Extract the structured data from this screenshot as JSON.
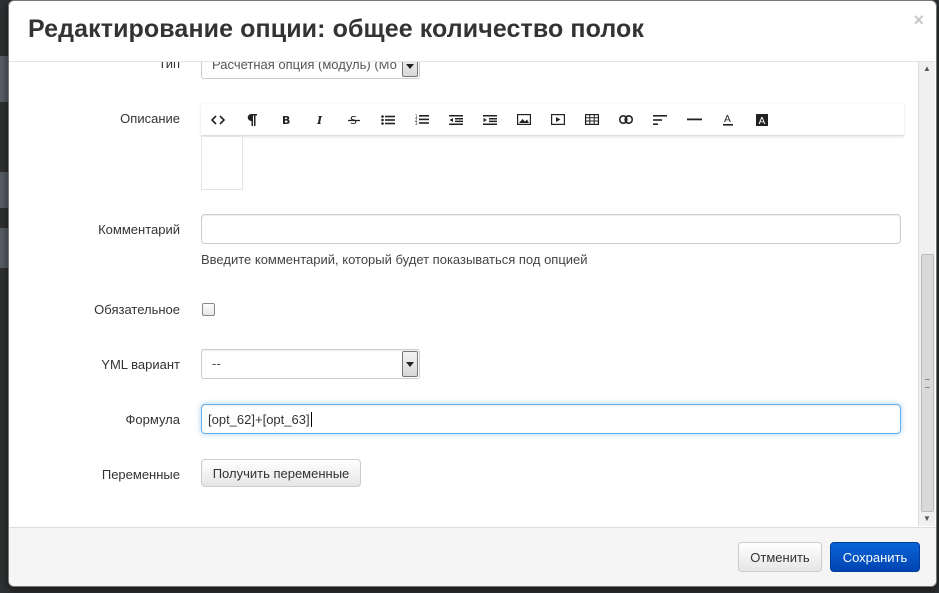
{
  "modal": {
    "title": "Редактирование опции: общее количество полок",
    "close_glyph": "×"
  },
  "form": {
    "type": {
      "label": "Тип",
      "value": "Расчетная опция (модуль) (Мо"
    },
    "description": {
      "label": "Описание",
      "toolbar": [
        {
          "icon": "code-view-icon",
          "glyph": "<>"
        },
        {
          "icon": "paragraph-icon",
          "glyph": "¶"
        },
        {
          "icon": "bold-icon",
          "glyph": "B"
        },
        {
          "icon": "italic-icon",
          "glyph": "I"
        },
        {
          "icon": "strikethrough-icon",
          "glyph": "S"
        },
        {
          "icon": "unordered-list-icon",
          "glyph": ""
        },
        {
          "icon": "ordered-list-icon",
          "glyph": ""
        },
        {
          "icon": "outdent-icon",
          "glyph": ""
        },
        {
          "icon": "indent-icon",
          "glyph": ""
        },
        {
          "icon": "image-icon",
          "glyph": ""
        },
        {
          "icon": "video-icon",
          "glyph": ""
        },
        {
          "icon": "table-icon",
          "glyph": ""
        },
        {
          "icon": "link-icon",
          "glyph": ""
        },
        {
          "icon": "align-icon",
          "glyph": ""
        },
        {
          "icon": "horizontal-rule-icon",
          "glyph": ""
        },
        {
          "icon": "font-color-icon",
          "glyph": "A"
        },
        {
          "icon": "background-color-icon",
          "glyph": "A"
        }
      ]
    },
    "comment": {
      "label": "Комментарий",
      "value": "",
      "help": "Введите комментарий, который будет показываться под опцией"
    },
    "required": {
      "label": "Обязательное",
      "checked": false
    },
    "yml_variant": {
      "label": "YML вариант",
      "value": "--"
    },
    "formula": {
      "label": "Формула",
      "value": "[opt_62]+[opt_63]"
    },
    "variables": {
      "label": "Переменные",
      "button_label": "Получить переменные"
    }
  },
  "footer": {
    "cancel_label": "Отменить",
    "save_label": "Сохранить"
  },
  "colors": {
    "primary": "#0a5ad0",
    "focus": "#66afe9",
    "overlay": "#2f3133"
  }
}
